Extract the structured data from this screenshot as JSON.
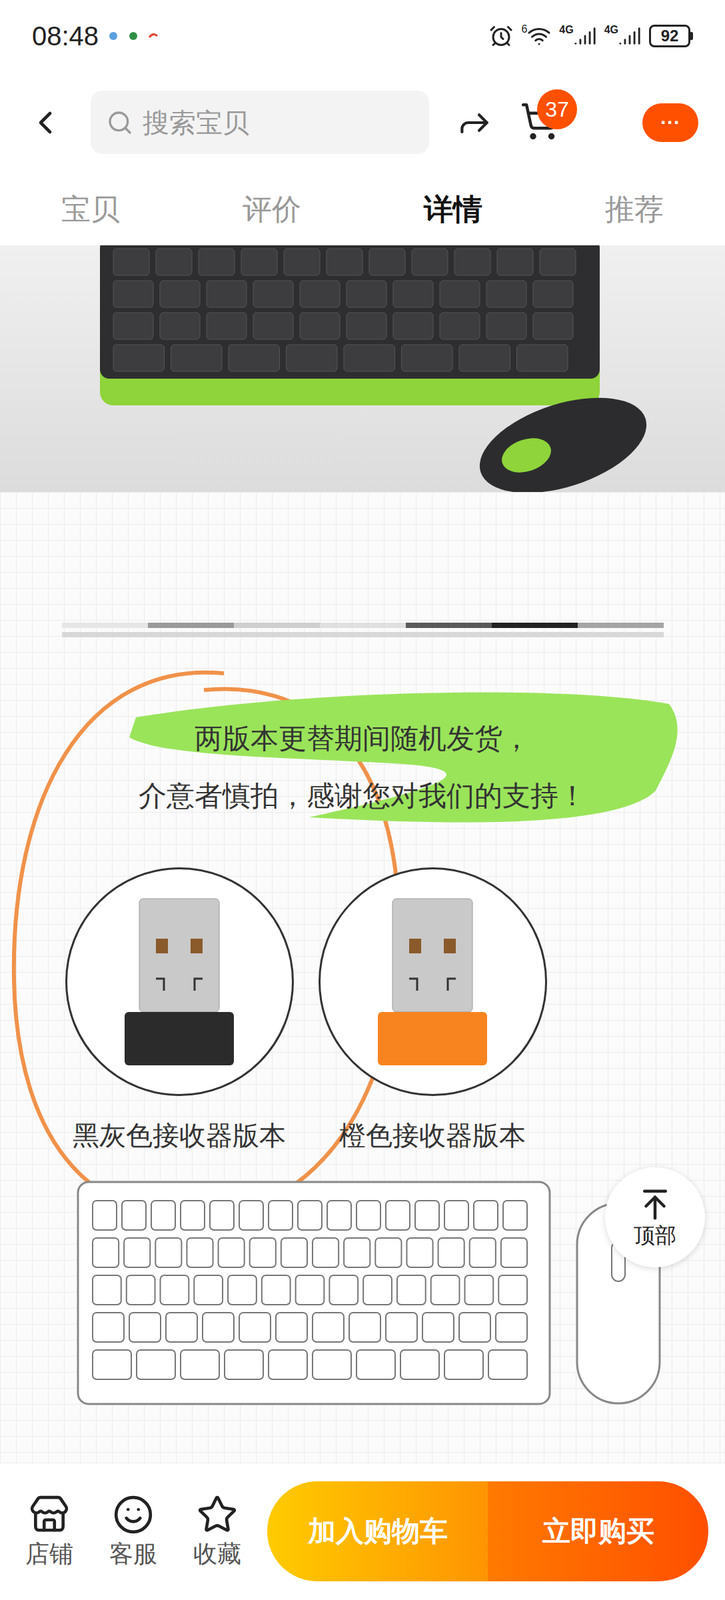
{
  "status_bar": {
    "time": "08:48",
    "wifi_label": "6",
    "networks": [
      "4G",
      "4G"
    ],
    "battery": "92"
  },
  "header": {
    "search_placeholder": "搜索宝贝",
    "cart_count": "37",
    "more": "···"
  },
  "tabs": [
    {
      "label": "宝贝",
      "selected": false
    },
    {
      "label": "评价",
      "selected": false
    },
    {
      "label": "详情",
      "selected": true
    },
    {
      "label": "推荐",
      "selected": false
    }
  ],
  "notice": {
    "lines": [
      "两版本更替期间随机发货，",
      "介意者慎拍，感谢您对我们的支持！"
    ]
  },
  "receivers": [
    {
      "label": "黑灰色接收器版本",
      "color": "#2b2b2b"
    },
    {
      "label": "橙色接收器版本",
      "color": "#f7841f"
    }
  ],
  "back_to_top": "顶部",
  "bottom_bar": {
    "actions": [
      "店铺",
      "客服",
      "收藏"
    ],
    "buttons": [
      "加入购物车",
      "立即购买"
    ]
  }
}
